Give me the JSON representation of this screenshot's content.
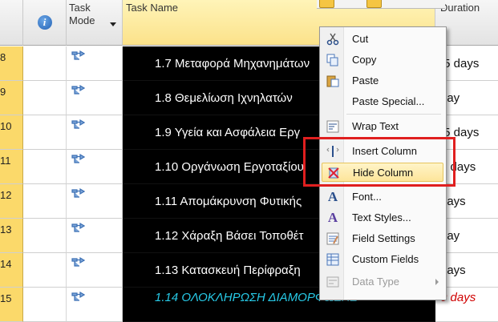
{
  "header": {
    "info_label": "i",
    "task_mode_label": "Task\nMode",
    "task_name_label": "Task Name",
    "duration_label": "Duration"
  },
  "rows": [
    {
      "id": "8",
      "name": "1.7 Μεταφορά Μηχανημάτων",
      "duration": ".5 days"
    },
    {
      "id": "9",
      "name": "1.8 Θεμελίωση Ιχνηλατών",
      "duration": "day"
    },
    {
      "id": "10",
      "name": "1.9 Υγεία και Ασφάλεια Εργ",
      "duration": ".5 days"
    },
    {
      "id": "11",
      "name": "1.10 Οργάνωση Εργοταξίου",
      "duration": "4 days"
    },
    {
      "id": "12",
      "name": "1.11 Απομάκρυνση Φυτικής",
      "duration": "days"
    },
    {
      "id": "13",
      "name": "1.12 Χάραξη Βάσει Τοποθέτ",
      "duration": "day"
    },
    {
      "id": "14",
      "name": "1.13 Κατασκευή Περίφραξη",
      "duration": "days"
    },
    {
      "id": "15",
      "name": "1.14 ΟΛΟΚΛΗΡΩΣΗ ΔΙΑΜΟΡΦΩΣΗΣ",
      "duration": "0 days"
    }
  ],
  "menu": {
    "items": [
      {
        "label": "Cut",
        "icon": "scissors-icon"
      },
      {
        "label": "Copy",
        "icon": "copy-icon"
      },
      {
        "label": "Paste",
        "icon": "paste-icon"
      },
      {
        "label": "Paste Special...",
        "icon": ""
      },
      {
        "label": "Wrap Text",
        "icon": "wrap-text-icon"
      },
      {
        "label": "Insert Column",
        "icon": "insert-column-icon"
      },
      {
        "label": "Hide Column",
        "icon": "hide-column-icon"
      },
      {
        "label": "Font...",
        "icon": "font-icon"
      },
      {
        "label": "Text Styles...",
        "icon": "text-styles-icon"
      },
      {
        "label": "Field Settings",
        "icon": "field-settings-icon"
      },
      {
        "label": "Custom Fields",
        "icon": "custom-fields-icon"
      },
      {
        "label": "Data Type",
        "icon": "data-type-icon"
      }
    ]
  },
  "colors": {
    "row_id_bg": "#fbd96a",
    "selected_column_bg": "#000000",
    "summary_text": "#27c9e6",
    "summary_duration": "#d00000",
    "highlight_box": "#e01f1f",
    "menu_highlight": "#fde59a"
  }
}
